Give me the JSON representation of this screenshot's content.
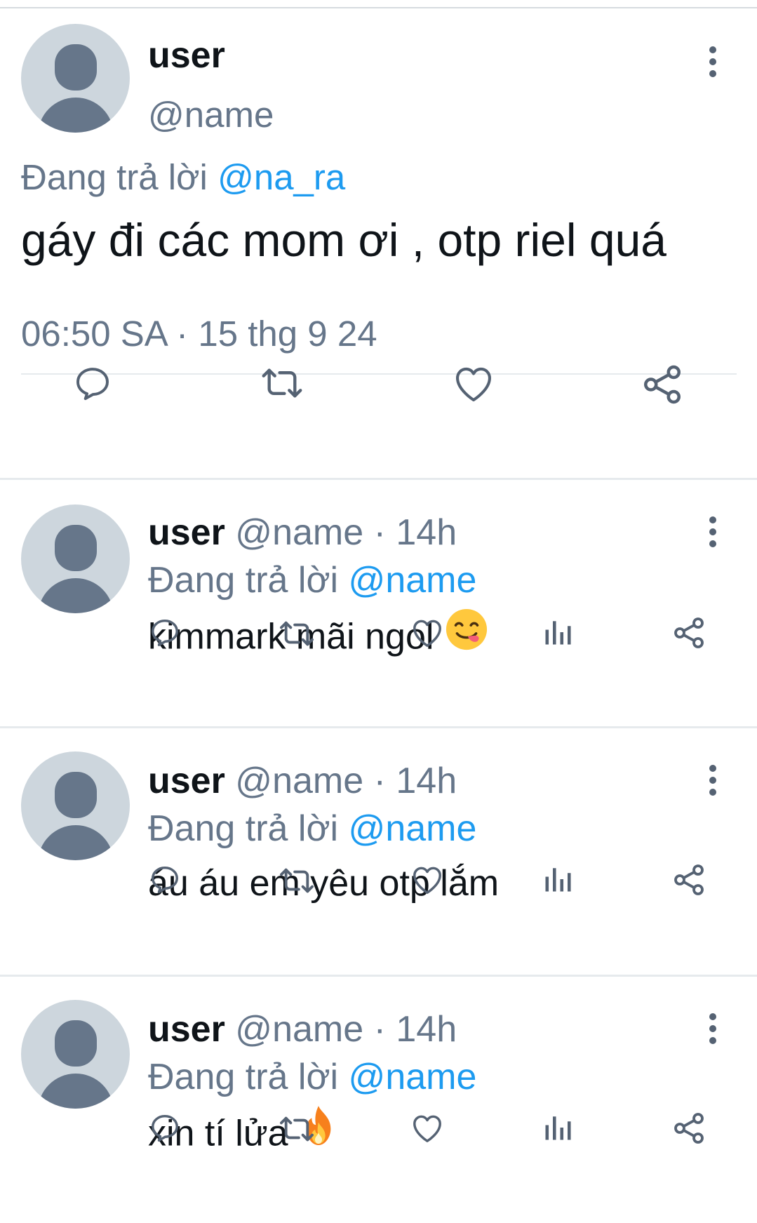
{
  "main_tweet": {
    "display_name": "user",
    "handle": "@name",
    "reply_prefix": "Đang trả lời ",
    "reply_mention": "@na_ra",
    "text": "gáy đi các mom ơi , otp riel quá",
    "timestamp": "06:50 SA · 15 thg 9 24",
    "actions": [
      "reply-icon",
      "retweet-icon",
      "like-icon",
      "share-icon"
    ]
  },
  "replies": [
    {
      "display_name": "user",
      "handle_time": "@name · 14h",
      "reply_prefix": "Đang trả lời ",
      "reply_mention": "@name",
      "text": "kimmark mãi ngol",
      "emoji": "savoring-face-emoji"
    },
    {
      "display_name": "user",
      "handle_time": "@name · 14h",
      "reply_prefix": "Đang trả lời ",
      "reply_mention": "@name",
      "text": "áu áu em yêu otp lắm",
      "emoji": ""
    },
    {
      "display_name": "user",
      "handle_time": "@name · 14h",
      "reply_prefix": "Đang trả lời ",
      "reply_mention": "@name",
      "text": "xin tí lửa",
      "emoji": "fire-emoji"
    }
  ],
  "reply_actions": [
    "reply-icon",
    "retweet-icon",
    "like-icon",
    "analytics-icon",
    "share-icon"
  ],
  "colors": {
    "text": "#0f1419",
    "secondary": "#66768a",
    "mention": "#1d9bf0",
    "avatar_bg": "#cdd6dd",
    "avatar_fg": "#66768a",
    "divider": "#e6eaed"
  }
}
